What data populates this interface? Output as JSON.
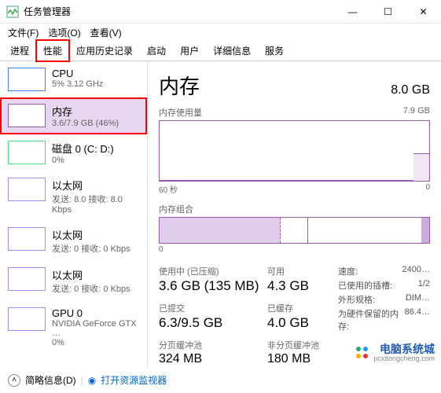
{
  "window": {
    "title": "任务管理器",
    "menu": {
      "file": "文件(F)",
      "options": "选项(O)",
      "view": "查看(V)"
    },
    "controls": {
      "min": "—",
      "max": "☐",
      "close": "✕"
    }
  },
  "tabs": [
    "进程",
    "性能",
    "应用历史记录",
    "启动",
    "用户",
    "详细信息",
    "服务"
  ],
  "sidebar": [
    {
      "name": "CPU",
      "detail": "5% 3.12 GHz"
    },
    {
      "name": "内存",
      "detail": "3.6/7.9 GB (46%)"
    },
    {
      "name": "磁盘 0 (C: D:)",
      "detail": "0%"
    },
    {
      "name": "以太网",
      "detail": "发送: 8.0 接收: 8.0 Kbps"
    },
    {
      "name": "以太网",
      "detail": "发送: 0 接收: 0 Kbps"
    },
    {
      "name": "以太网",
      "detail": "发送: 0 接收: 0 Kbps"
    },
    {
      "name": "GPU 0",
      "detail": "NVIDIA GeForce GTX …",
      "detail2": "0%"
    }
  ],
  "main": {
    "title": "内存",
    "total": "8.0 GB",
    "usage_label": "内存使用量",
    "usage_max": "7.9 GB",
    "axis_left": "60 秒",
    "axis_right": "0",
    "comp_label": "内存组合",
    "axis_zero": "0",
    "stats": {
      "in_use_label": "使用中 (已压缩)",
      "in_use": "3.6 GB (135 MB)",
      "available_label": "可用",
      "available": "4.3 GB",
      "committed_label": "已提交",
      "committed": "6.3/9.5 GB",
      "cached_label": "已缓存",
      "cached": "4.0 GB",
      "paged_label": "分页缓冲池",
      "paged": "324 MB",
      "nonpaged_label": "非分页缓冲池",
      "nonpaged": "180 MB"
    },
    "right_stats": {
      "speed_label": "速度:",
      "speed": "2400…",
      "slots_label": "已使用的插槽:",
      "slots": "1/2",
      "form_label": "外形规格:",
      "form": "DIM…",
      "reserved_label": "为硬件保留的内存:",
      "reserved": "86.4…"
    }
  },
  "footer": {
    "fewer": "简略信息(D)",
    "resmon": "打开资源监视器"
  },
  "watermark": {
    "brand": "电脑系统城",
    "url": "pcxitongcheng.com"
  },
  "chart_data": {
    "type": "line",
    "title": "内存使用量",
    "ylabel": "GB",
    "ylim": [
      0,
      7.9
    ],
    "x_range_seconds": 60,
    "current_value_gb": 3.6,
    "note": "History not yet accumulated; only rightmost sample visible at ~46%"
  }
}
